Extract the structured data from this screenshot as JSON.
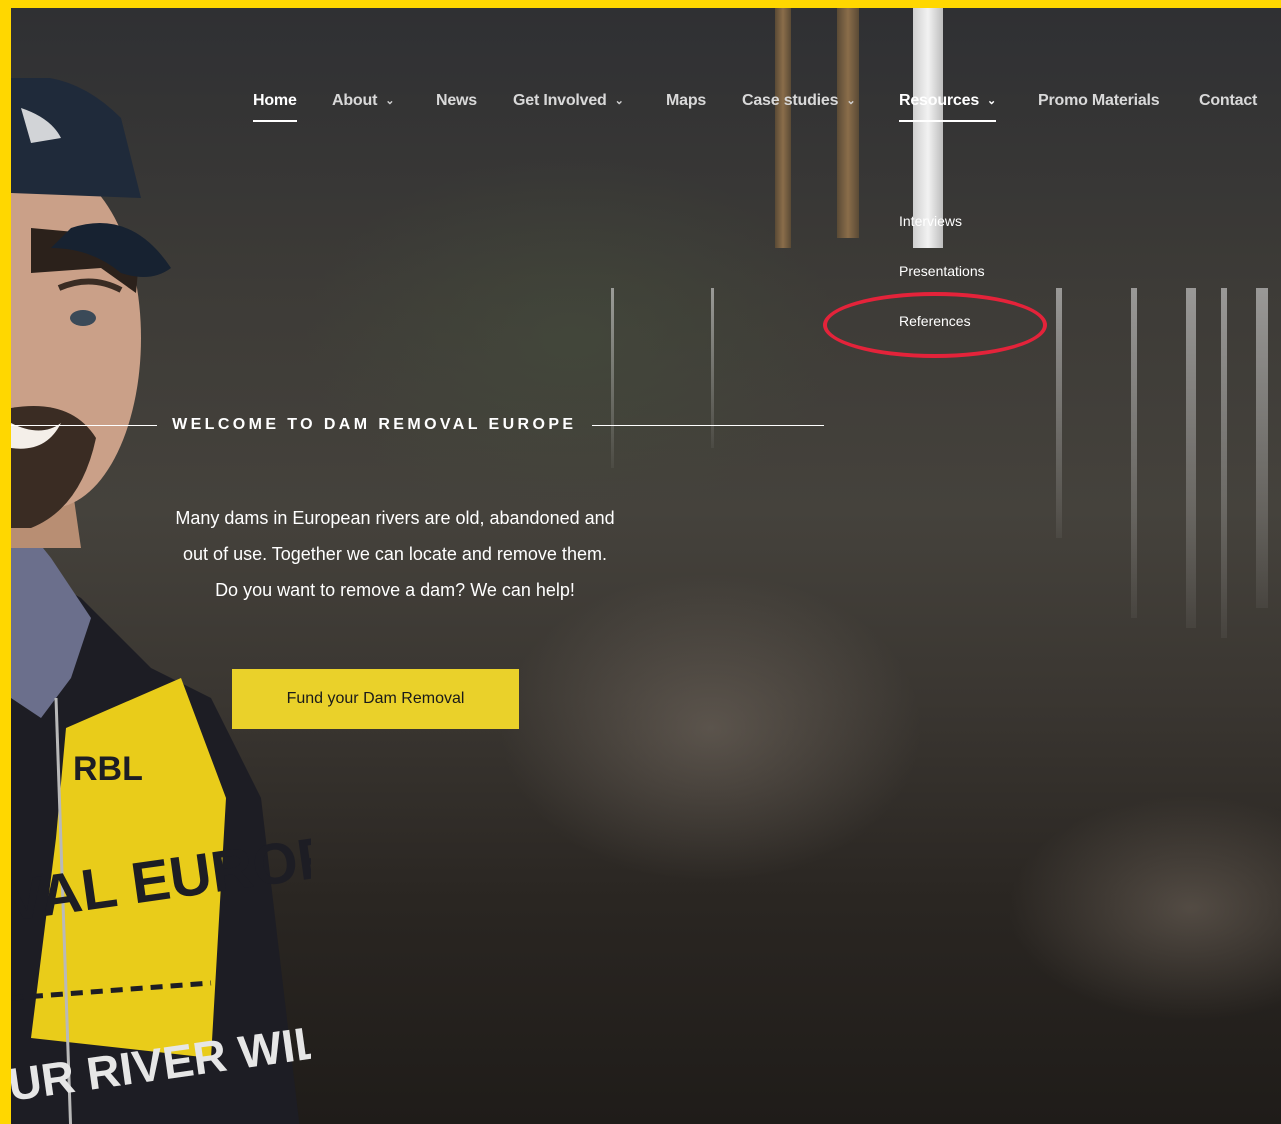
{
  "nav": {
    "items": [
      {
        "label": "Home",
        "chevron": false
      },
      {
        "label": "About",
        "chevron": true
      },
      {
        "label": "News",
        "chevron": false
      },
      {
        "label": "Get Involved",
        "chevron": true
      },
      {
        "label": "Maps",
        "chevron": false
      },
      {
        "label": "Case studies",
        "chevron": true
      },
      {
        "label": "Resources",
        "chevron": true
      },
      {
        "label": "Promo Materials",
        "chevron": false
      },
      {
        "label": "Contact",
        "chevron": false
      }
    ],
    "chevron_glyph": "⌄",
    "active": "Resources"
  },
  "resources_dropdown": {
    "items": [
      "Interviews",
      "Presentations",
      "References"
    ],
    "highlighted": "References",
    "highlight_color": "#e4233a"
  },
  "hero": {
    "welcome_title": "WELCOME TO DAM REMOVAL EUROPE",
    "intro_lines": [
      "Many dams in European rivers are old, abandoned and",
      "out of use. Together we can locate and remove them.",
      "Do you want to remove a dam? We can help!"
    ],
    "cta_label": "Fund your Dam Removal",
    "cta_color": "#ead12a"
  },
  "jacket_print": {
    "logo": "RBL",
    "line1": "VAL EUROPE",
    "line2": "UR RIVER WIL"
  },
  "colors": {
    "frame": "#ffd700",
    "cap": "#1f2a3a",
    "jacket_yellow": "#e9cc1a",
    "jacket_dark": "#1d1d24"
  }
}
